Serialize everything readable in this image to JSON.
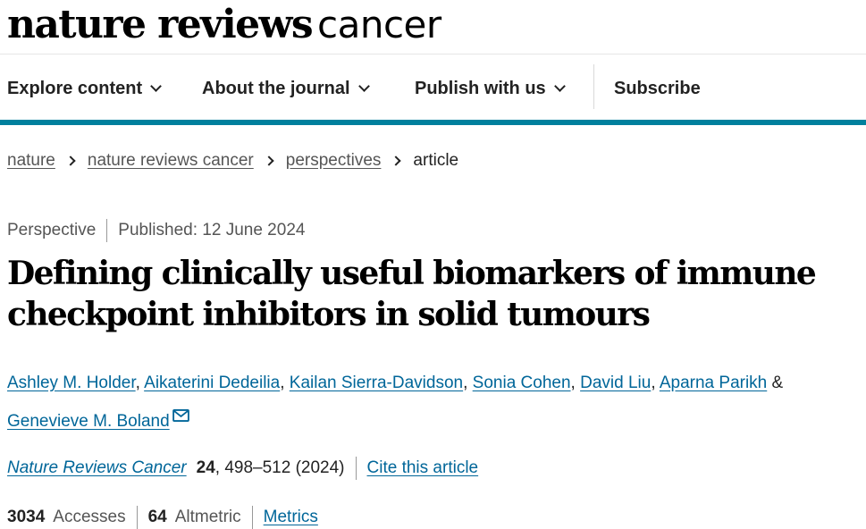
{
  "masthead": {
    "brand_bold": "nature reviews",
    "brand_light": "cancer"
  },
  "nav": {
    "items": [
      {
        "label": "Explore content",
        "has_dropdown": true
      },
      {
        "label": "About the journal",
        "has_dropdown": true
      },
      {
        "label": "Publish with us",
        "has_dropdown": true
      },
      {
        "label": "Subscribe",
        "has_dropdown": false
      }
    ]
  },
  "breadcrumb": {
    "items": [
      "nature",
      "nature reviews cancer",
      "perspectives"
    ],
    "current": "article"
  },
  "article": {
    "type": "Perspective",
    "published": "Published: 12 June 2024",
    "title": "Defining clinically useful biomarkers of immune checkpoint inhibitors in solid tumours",
    "authors": [
      "Ashley M. Holder",
      "Aikaterini Dedeilia",
      "Kailan Sierra-Davidson",
      "Sonia Cohen",
      "David Liu",
      "Aparna Parikh",
      "Genevieve M. Boland"
    ],
    "author_separator": ", ",
    "author_ampersand": " &",
    "citation": {
      "journal": "Nature Reviews Cancer",
      "volume": "24",
      "pages_year": ", 498–512 (2024)",
      "cite_label": "Cite this article"
    },
    "metrics": {
      "accesses_value": "3034",
      "accesses_label": "Accesses",
      "altmetric_value": "64",
      "altmetric_label": "Altmetric",
      "metrics_link": "Metrics"
    }
  },
  "colors": {
    "accent": "#00809d",
    "link": "#006699"
  }
}
